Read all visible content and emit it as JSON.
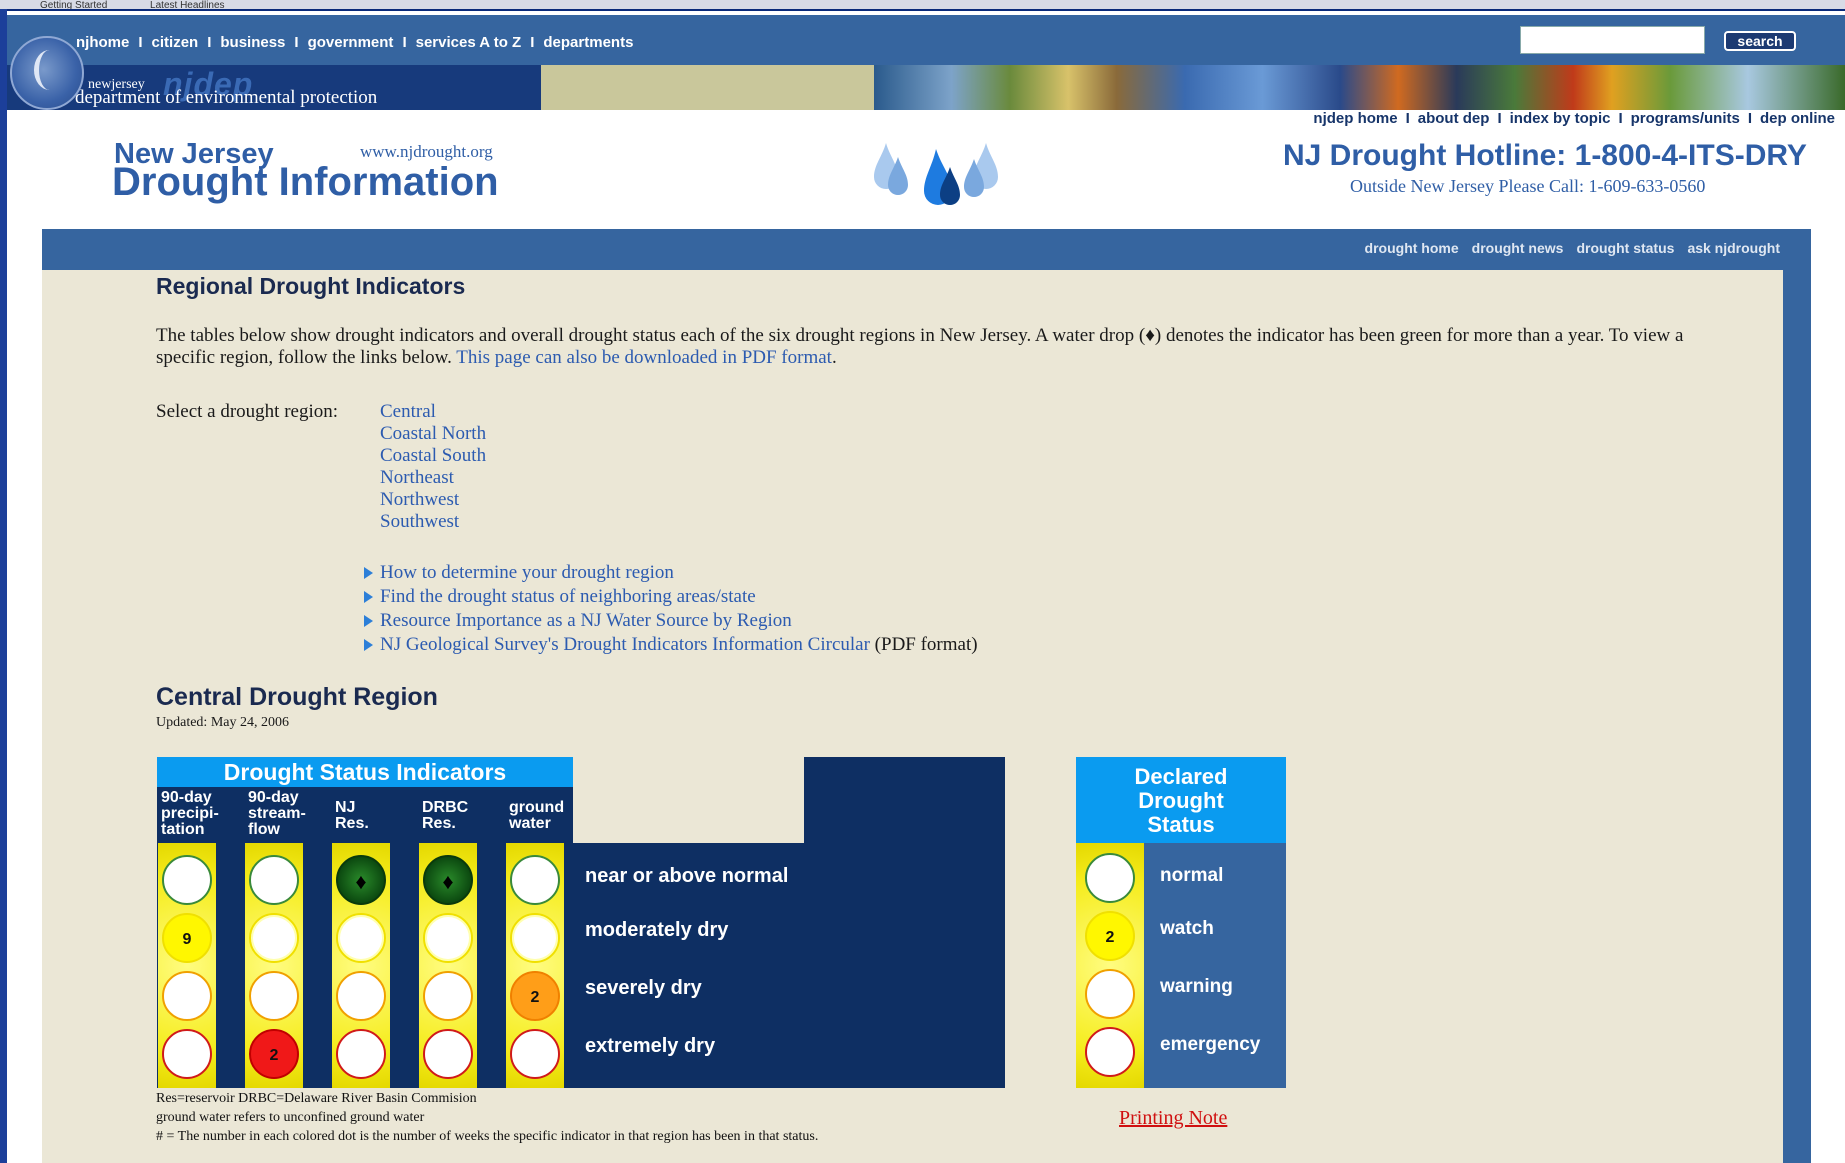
{
  "browser_strip": {
    "items": [
      "Getting Started",
      "Latest Headlines"
    ]
  },
  "topnav": {
    "links": [
      "njhome",
      "citizen",
      "business",
      "government",
      "services A to Z",
      "departments"
    ],
    "separator": "I",
    "search_button": "search"
  },
  "banner": {
    "small_text": "newjersey",
    "big_text": "njdep",
    "dept_text": "department of environmental protection"
  },
  "util_links": {
    "links": [
      "njdep home",
      "about dep",
      "index by topic",
      "programs/units",
      "dep online"
    ],
    "separator": "I"
  },
  "header": {
    "title_line1": "New Jersey",
    "title_line2": "Drought Information",
    "url": "www.njdrought.org",
    "hotline": "NJ Drought Hotline: 1-800-4-ITS-DRY",
    "hotline_sub": "Outside New Jersey Please Call: 1-609-633-0560",
    "drop_colors": [
      "#a9c9ee",
      "#7aa8de",
      "#1e7be0",
      "#0c3f84",
      "#a9c9ee",
      "#7aa8de"
    ]
  },
  "subnav": {
    "links": [
      "drought home",
      "drought news",
      "drought status",
      "ask njdrought"
    ]
  },
  "content": {
    "heading": "Regional Drought Indicators",
    "intro_part1": "The tables below show drought indicators and overall drought status each of the six drought regions in New Jersey. A water drop (",
    "intro_drop": "♦",
    "intro_part2": ") denotes the indicator has been green for more than a year. To view a specific region, follow the links below. ",
    "intro_link": "This page can also be downloaded in PDF format",
    "intro_end": ".",
    "select_label": "Select a drought region:",
    "regions": [
      "Central",
      "Coastal North",
      "Coastal South",
      "Northeast",
      "Northwest",
      "Southwest"
    ],
    "bullet_links": [
      {
        "text": "How to determine your drought region",
        "suffix": ""
      },
      {
        "text": "Find the drought status of neighboring areas/state",
        "suffix": ""
      },
      {
        "text": "Resource Importance as a NJ Water Source by Region",
        "suffix": ""
      },
      {
        "text": "NJ Geological Survey's Drought Indicators Information Circular",
        "suffix": " (PDF format)"
      }
    ],
    "region_title": "Central Drought Region",
    "updated": "Updated: May 24, 2006"
  },
  "indicators": {
    "header": "Drought Status Indicators",
    "columns": [
      {
        "label": [
          "90-day",
          "precipi-",
          "tation"
        ],
        "states": [
          {
            "style": "w-green",
            "num": ""
          },
          {
            "style": "f-yellow",
            "num": "9"
          },
          {
            "style": "w-orange",
            "num": ""
          },
          {
            "style": "w-red",
            "num": ""
          }
        ]
      },
      {
        "label": [
          "90-day",
          "stream-",
          "flow"
        ],
        "states": [
          {
            "style": "w-green",
            "num": ""
          },
          {
            "style": "w-yellow",
            "num": ""
          },
          {
            "style": "w-orange",
            "num": ""
          },
          {
            "style": "f-red",
            "num": "2"
          }
        ]
      },
      {
        "label": [
          "NJ",
          "Res."
        ],
        "states": [
          {
            "style": "f-green",
            "num": "♦"
          },
          {
            "style": "w-yellow",
            "num": ""
          },
          {
            "style": "w-orange",
            "num": ""
          },
          {
            "style": "w-red",
            "num": ""
          }
        ]
      },
      {
        "label": [
          "DRBC",
          "Res."
        ],
        "states": [
          {
            "style": "f-green",
            "num": "♦"
          },
          {
            "style": "w-yellow",
            "num": ""
          },
          {
            "style": "w-orange",
            "num": ""
          },
          {
            "style": "w-red",
            "num": ""
          }
        ]
      },
      {
        "label": [
          "ground",
          "water"
        ],
        "states": [
          {
            "style": "w-green",
            "num": ""
          },
          {
            "style": "w-yellow",
            "num": ""
          },
          {
            "style": "f-orange",
            "num": "2"
          },
          {
            "style": "w-red",
            "num": ""
          }
        ]
      }
    ],
    "row_labels": [
      "near or above normal",
      "moderately dry",
      "severely dry",
      "extremely dry"
    ],
    "footnotes": [
      "Res=reservoir DRBC=Delaware River Basin Commision",
      "ground water refers to unconfined ground water",
      "# = The number in each colored dot is the number of weeks the specific indicator in that region has been in that status."
    ]
  },
  "declared": {
    "header": [
      "Declared",
      "Drought",
      "Status"
    ],
    "states": [
      {
        "label": "normal",
        "style": "w-green",
        "num": ""
      },
      {
        "label": "watch",
        "style": "f-yellow",
        "num": "2"
      },
      {
        "label": "warning",
        "style": "w-orange",
        "num": ""
      },
      {
        "label": "emergency",
        "style": "w-red",
        "num": ""
      }
    ],
    "printing_note": "Printing Note"
  },
  "colors": {
    "nav_blue": "#36659f",
    "dark_navy": "#0e2f63",
    "header_cyan": "#0a9bf0",
    "content_bg": "#ebe7d6",
    "link_blue": "#2c5bb0"
  }
}
